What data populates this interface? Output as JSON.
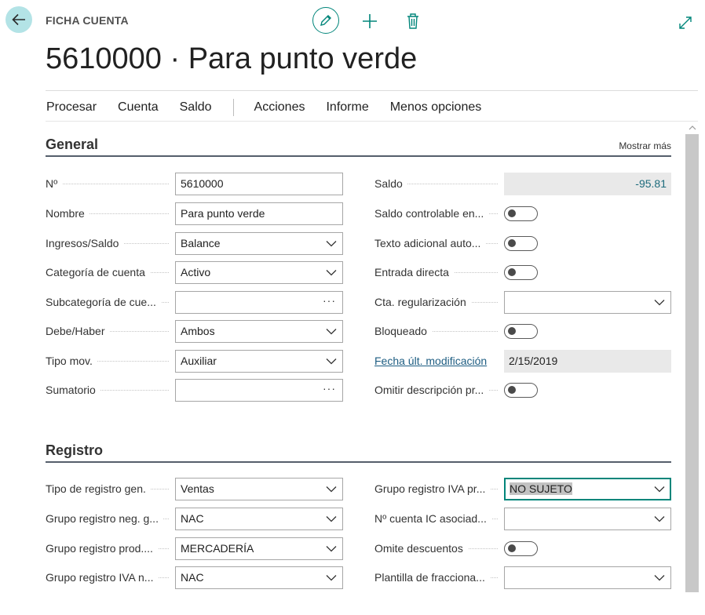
{
  "header": {
    "page_kind": "FICHA CUENTA",
    "title": "5610000 · Para punto verde",
    "icons": {
      "back": "arrow-left-icon",
      "edit": "pencil-icon",
      "new": "plus-icon",
      "delete": "trash-icon",
      "expand": "expand-icon"
    },
    "accent_color": "#00857a"
  },
  "actions": {
    "group1": [
      "Procesar",
      "Cuenta",
      "Saldo"
    ],
    "group2": [
      "Acciones",
      "Informe",
      "Menos opciones"
    ]
  },
  "general": {
    "title": "General",
    "show_more": "Mostrar más",
    "left": [
      {
        "label": "Nº",
        "type": "text",
        "value": "5610000"
      },
      {
        "label": "Nombre",
        "type": "text",
        "value": "Para punto verde"
      },
      {
        "label": "Ingresos/Saldo",
        "type": "select",
        "value": "Balance"
      },
      {
        "label": "Categoría de cuenta",
        "type": "select",
        "value": "Activo"
      },
      {
        "label": "Subcategoría de cue...",
        "type": "lookup",
        "value": ""
      },
      {
        "label": "Debe/Haber",
        "type": "select",
        "value": "Ambos"
      },
      {
        "label": "Tipo mov.",
        "type": "select",
        "value": "Auxiliar"
      },
      {
        "label": "Sumatorio",
        "type": "lookup",
        "value": ""
      }
    ],
    "right": [
      {
        "label": "Saldo",
        "type": "readonly-number",
        "value": "-95.81"
      },
      {
        "label": "Saldo controlable en...",
        "type": "toggle",
        "value": "off"
      },
      {
        "label": "Texto adicional auto...",
        "type": "toggle",
        "value": "off"
      },
      {
        "label": "Entrada directa",
        "type": "toggle",
        "value": "off"
      },
      {
        "label": "Cta. regularización",
        "type": "select",
        "value": ""
      },
      {
        "label": "Bloqueado",
        "type": "toggle",
        "value": "off"
      },
      {
        "label": "Fecha últ. modificación",
        "type": "readonly",
        "value": "2/15/2019"
      },
      {
        "label": "Omitir descripción pr...",
        "type": "toggle",
        "value": "off"
      }
    ]
  },
  "registro": {
    "title": "Registro",
    "left": [
      {
        "label": "Tipo de registro gen.",
        "type": "select",
        "value": "Ventas"
      },
      {
        "label": "Grupo registro neg. g...",
        "type": "select",
        "value": "NAC"
      },
      {
        "label": "Grupo registro prod....",
        "type": "select",
        "value": "MERCADERÍA"
      },
      {
        "label": "Grupo registro IVA n...",
        "type": "select",
        "value": "NAC"
      }
    ],
    "right": [
      {
        "label": "Grupo registro IVA pr...",
        "type": "select",
        "value": "NO SUJETO"
      },
      {
        "label": "Nº cuenta IC asociad...",
        "type": "select",
        "value": ""
      },
      {
        "label": "Omite descuentos",
        "type": "toggle",
        "value": "off"
      },
      {
        "label": "Plantilla de fracciona...",
        "type": "select",
        "value": ""
      }
    ]
  }
}
